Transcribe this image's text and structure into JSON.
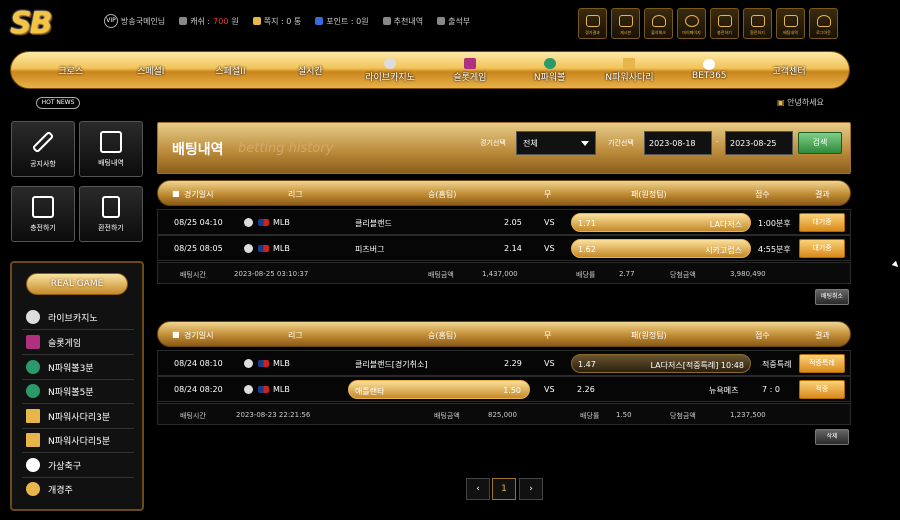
{
  "logo": "SB",
  "user": {
    "level_badge": "VIP",
    "name": "방송국메인님",
    "cash_label": "캐쉬 :",
    "cash_value": "700",
    "cash_unit": "원",
    "msg_label": "쪽지 : 0 통",
    "point_label": "포인트 : 0원",
    "recommend_label": "추천내역",
    "attendance_label": "출석부"
  },
  "top_icons": [
    "경기결과",
    "게시판",
    "출석체크",
    "마이페이지",
    "충전하기",
    "환전하기",
    "배팅내역",
    "로그아웃"
  ],
  "nav": [
    "크로스",
    "스페셜I",
    "스페셜II",
    "실시간",
    "라이브카지노",
    "슬롯게임",
    "N파워볼",
    "N파워사다리",
    "BET365",
    "고객센터"
  ],
  "hot_news": "HOT NEWS",
  "greeting": "안녕하세요",
  "side_buttons": [
    "공지사항",
    "배팅내역",
    "충전하기",
    "환전하기"
  ],
  "real_game": {
    "title": "REAL GAME",
    "items": [
      "라이브카지노",
      "슬롯게임",
      "N파워볼3분",
      "N파워볼5분",
      "N파워사다리3분",
      "N파워사다리5분",
      "가상축구",
      "개경주"
    ]
  },
  "betting": {
    "title": "배팅내역",
    "subtitle": "betting history",
    "filter_label": "경기선택",
    "filter_value": "전체",
    "period_label": "기간선택",
    "date_from": "2023-08-18",
    "date_to": "2023-08-25",
    "search": "검색"
  },
  "table_headers": [
    "경기일시",
    "리그",
    "승(홈팀)",
    "무",
    "패(원정팀)",
    "점수",
    "결과"
  ],
  "bet_groups": [
    {
      "rows": [
        {
          "time": "08/25 04:10",
          "league": "MLB",
          "home": "클리블랜드",
          "home_odds": "2.05",
          "draw": "VS",
          "away_odds": "1.71",
          "away": "LA다저스",
          "score": "1:00분후",
          "result": "대기중",
          "pick": "away"
        },
        {
          "time": "08/25 08:05",
          "league": "MLB",
          "home": "피츠버그",
          "home_odds": "2.14",
          "draw": "VS",
          "away_odds": "1.62",
          "away": "시카고컵스",
          "score": "4:55분후",
          "result": "대기중",
          "pick": "away"
        }
      ],
      "summary": {
        "bet_time_label": "배팅시간",
        "bet_time": "2023-08-25 03:10:37",
        "amount_label": "배팅금액",
        "amount": "1,437,000",
        "rate_label": "배당률",
        "rate": "2.77",
        "win_label": "당첨금액",
        "win": "3,980,490"
      },
      "action": "배팅취소"
    },
    {
      "rows": [
        {
          "time": "08/24 08:10",
          "league": "MLB",
          "home": "클리블랜드[경기취소]",
          "home_odds": "2.29",
          "draw": "VS",
          "away_odds": "1.47",
          "away": "LA다저스[적중특례] 10:48",
          "score": "적중특례",
          "result": "적중특례",
          "pick": "away"
        },
        {
          "time": "08/24 08:20",
          "league": "MLB",
          "home": "애틀랜타",
          "home_odds": "1.50",
          "draw": "VS",
          "away_odds": "2.26",
          "away": "뉴욕메츠",
          "score": "7 : 0",
          "result": "적중",
          "pick": "home"
        }
      ],
      "summary": {
        "bet_time_label": "배팅시간",
        "bet_time": "2023-08-23 22:21:56",
        "amount_label": "배팅금액",
        "amount": "825,000",
        "rate_label": "배당률",
        "rate": "1.50",
        "win_label": "당첨금액",
        "win": "1,237,500"
      },
      "action": "삭제"
    }
  ],
  "pagination": {
    "prev": "‹",
    "current": "1",
    "next": "›"
  }
}
